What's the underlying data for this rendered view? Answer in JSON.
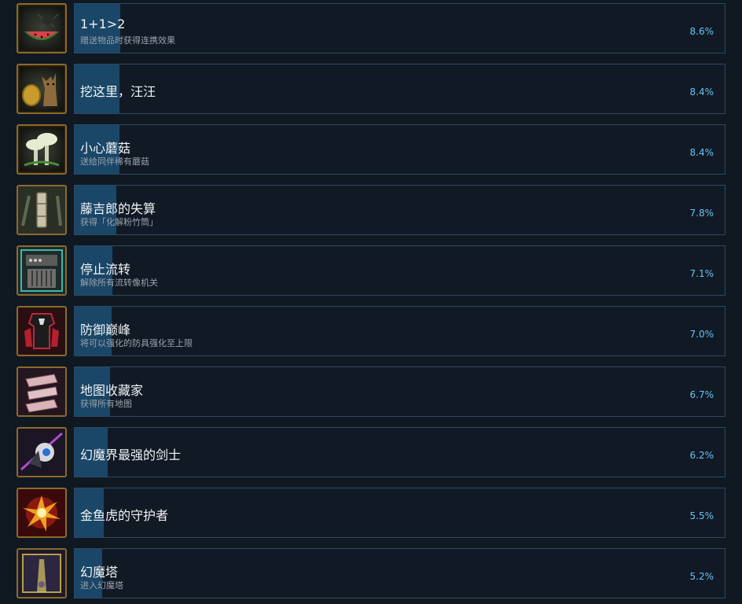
{
  "achievements": [
    {
      "title": "1+1>2",
      "desc": "赠送物品时获得连携效果",
      "percent": "8.6%",
      "progress": 0.086,
      "icon": "watermelon-beetle-icon"
    },
    {
      "title": "挖这里，汪汪",
      "desc": "",
      "percent": "8.4%",
      "progress": 0.084,
      "icon": "dog-coin-icon"
    },
    {
      "title": "小心蘑菇",
      "desc": "送给同伴稀有蘑菇",
      "percent": "8.4%",
      "progress": 0.084,
      "icon": "mushroom-icon"
    },
    {
      "title": "藤吉郎的失算",
      "desc": "获得「化解粉竹筒」",
      "percent": "7.8%",
      "progress": 0.078,
      "icon": "bamboo-tube-icon"
    },
    {
      "title": "停止流转",
      "desc": "解除所有流转像机关",
      "percent": "7.1%",
      "progress": 0.071,
      "icon": "mechanism-icon"
    },
    {
      "title": "防御巅峰",
      "desc": "将可以强化的防具强化至上限",
      "percent": "7.0%",
      "progress": 0.07,
      "icon": "armor-icon"
    },
    {
      "title": "地图收藏家",
      "desc": "获得所有地图",
      "percent": "6.7%",
      "progress": 0.067,
      "icon": "map-scroll-icon"
    },
    {
      "title": "幻魔界最强的剑士",
      "desc": "",
      "percent": "6.2%",
      "progress": 0.062,
      "icon": "swordsman-icon"
    },
    {
      "title": "金鱼虎的守护者",
      "desc": "",
      "percent": "5.5%",
      "progress": 0.055,
      "icon": "explosion-icon"
    },
    {
      "title": "幻魔塔",
      "desc": "进入幻魔塔",
      "percent": "5.2%",
      "progress": 0.052,
      "icon": "tower-icon"
    }
  ]
}
